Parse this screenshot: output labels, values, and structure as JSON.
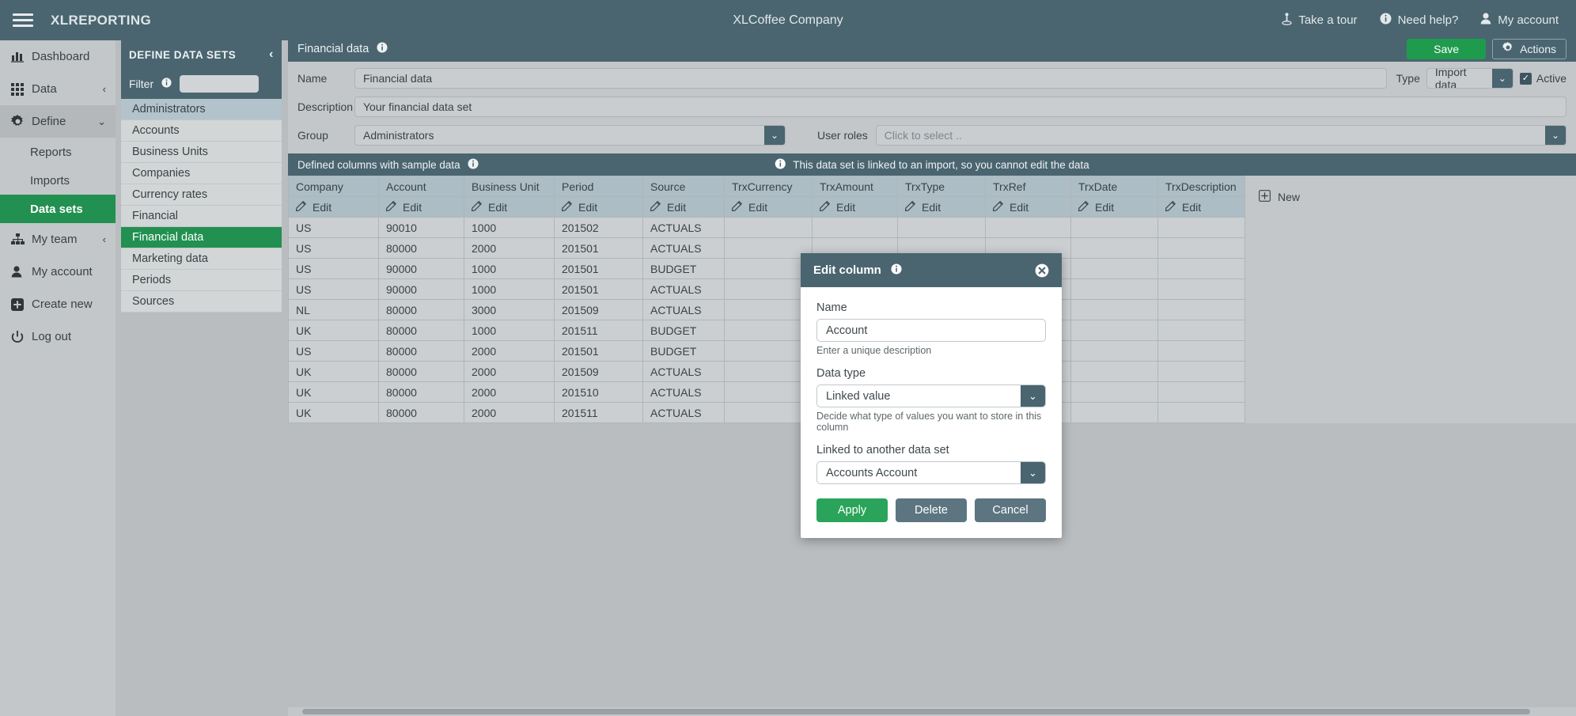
{
  "topbar": {
    "brand": "XLREPORTING",
    "center_title": "XLCoffee Company",
    "menu_icon": "hamburger-icon",
    "items": [
      {
        "label": "Take a tour",
        "icon": "tour-icon"
      },
      {
        "label": "Need help?",
        "icon": "info-icon"
      },
      {
        "label": "My account",
        "icon": "user-icon"
      }
    ]
  },
  "sidebar": {
    "items": [
      {
        "label": "Dashboard",
        "icon": "chart-bar-icon",
        "caret": ""
      },
      {
        "label": "Data",
        "icon": "grid-icon",
        "caret": "‹"
      },
      {
        "label": "Define",
        "icon": "gear-icon",
        "caret": "⌄"
      },
      {
        "label": "My team",
        "icon": "sitemap-icon",
        "caret": "‹"
      },
      {
        "label": "My account",
        "icon": "user-icon",
        "caret": ""
      },
      {
        "label": "Create new",
        "icon": "plus-square-icon",
        "caret": ""
      },
      {
        "label": "Log out",
        "icon": "power-icon",
        "caret": ""
      }
    ],
    "define_children": [
      {
        "label": "Reports",
        "selected": false
      },
      {
        "label": "Imports",
        "selected": false
      },
      {
        "label": "Data sets",
        "selected": true
      }
    ]
  },
  "datasets_panel": {
    "title": "DEFINE DATA SETS",
    "collapse_icon": "chevron-left-icon",
    "filter_label": "Filter",
    "filter_info_icon": "info-icon",
    "filter_value": "",
    "filter_placeholder": "",
    "items": [
      {
        "label": "Administrators",
        "state": "highlight"
      },
      {
        "label": "Accounts",
        "state": "normal"
      },
      {
        "label": "Business Units",
        "state": "normal"
      },
      {
        "label": "Companies",
        "state": "normal"
      },
      {
        "label": "Currency rates",
        "state": "normal"
      },
      {
        "label": "Financial",
        "state": "normal"
      },
      {
        "label": "Financial data",
        "state": "selected"
      },
      {
        "label": "Marketing data",
        "state": "normal"
      },
      {
        "label": "Periods",
        "state": "normal"
      },
      {
        "label": "Sources",
        "state": "normal"
      }
    ]
  },
  "main": {
    "header_title": "Financial data",
    "header_info_icon": "info-icon",
    "save_label": "Save",
    "actions_label": "Actions",
    "actions_icon": "gear-icon",
    "form": {
      "name_label": "Name",
      "name_value": "Financial data",
      "description_label": "Description",
      "description_value": "Your financial data set",
      "group_label": "Group",
      "group_value": "Administrators",
      "type_label": "Type",
      "type_value": "Import data",
      "active_label": "Active",
      "active_checked": true,
      "user_roles_label": "User roles",
      "user_roles_placeholder": "Click to select .."
    },
    "columns_bar": {
      "title": "Defined columns with sample data",
      "info_icon": "info-icon",
      "note": "This data set is linked to an import, so you cannot edit the data",
      "note_icon": "info-icon"
    },
    "table": {
      "headers": [
        "Company",
        "Account",
        "Business Unit",
        "Period",
        "Source",
        "TrxCurrency",
        "TrxAmount",
        "TrxType",
        "TrxRef",
        "TrxDate",
        "TrxDescription"
      ],
      "edit_label": "Edit",
      "edit_icon": "edit-pencil-icon",
      "new_label": "New",
      "new_icon": "plus-square-icon",
      "rows": [
        [
          "US",
          "90010",
          "1000",
          "201502",
          "ACTUALS",
          "",
          "",
          "",
          "",
          "",
          ""
        ],
        [
          "US",
          "80000",
          "2000",
          "201501",
          "ACTUALS",
          "",
          "",
          "",
          "",
          "",
          ""
        ],
        [
          "US",
          "90000",
          "1000",
          "201501",
          "BUDGET",
          "",
          "",
          "",
          "",
          "",
          ""
        ],
        [
          "US",
          "90000",
          "1000",
          "201501",
          "ACTUALS",
          "",
          "",
          "",
          "",
          "",
          ""
        ],
        [
          "NL",
          "80000",
          "3000",
          "201509",
          "ACTUALS",
          "",
          "",
          "",
          "",
          "",
          ""
        ],
        [
          "UK",
          "80000",
          "1000",
          "201511",
          "BUDGET",
          "",
          "",
          "",
          "",
          "",
          ""
        ],
        [
          "US",
          "80000",
          "2000",
          "201501",
          "BUDGET",
          "",
          "",
          "",
          "",
          "",
          ""
        ],
        [
          "UK",
          "80000",
          "2000",
          "201509",
          "ACTUALS",
          "",
          "",
          "",
          "",
          "",
          ""
        ],
        [
          "UK",
          "80000",
          "2000",
          "201510",
          "ACTUALS",
          "",
          "",
          "",
          "",
          "",
          ""
        ],
        [
          "UK",
          "80000",
          "2000",
          "201511",
          "ACTUALS",
          "",
          "",
          "",
          "",
          "",
          ""
        ]
      ]
    }
  },
  "modal": {
    "title": "Edit column",
    "title_info_icon": "info-icon",
    "close_icon": "close-circle-icon",
    "name_label": "Name",
    "name_value": "Account",
    "name_help": "Enter a unique description",
    "datatype_label": "Data type",
    "datatype_value": "Linked value",
    "datatype_help": "Decide what type of values you want to store in this column",
    "linked_label": "Linked to another data set",
    "linked_value": "Accounts Account",
    "apply_label": "Apply",
    "delete_label": "Delete",
    "cancel_label": "Cancel"
  },
  "colors": {
    "header_bg": "#4a6570",
    "accent_green": "#229050",
    "page_bg": "#b9bdbf",
    "panel_bg": "#c3c7c9",
    "table_header": "#adbdc5"
  }
}
